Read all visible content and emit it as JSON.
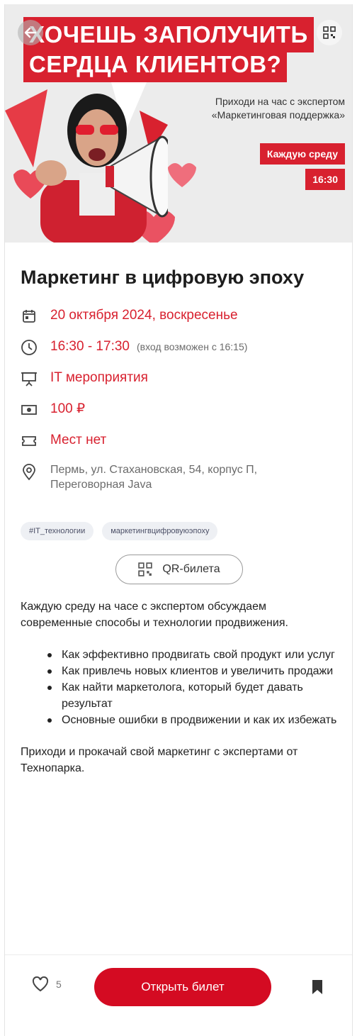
{
  "banner": {
    "headline_line1": "ХОЧЕШЬ ЗАПОЛУЧИТЬ",
    "headline_line2": "СЕРДЦА КЛИЕНТОВ?",
    "promo_line1": "Приходи на час с экспертом",
    "promo_line2": "«Маркетинговая поддержка»",
    "badge_day": "Каждую среду",
    "badge_time": "16:30"
  },
  "event": {
    "title": "Маркетинг в цифровую эпоху",
    "date": "20 октября 2024, воскресенье",
    "time": "16:30 - 17:30",
    "entry_note": "(вход возможен с 16:15)",
    "category": "IT мероприятия",
    "price": "100 ₽",
    "seats": "Мест нет",
    "address_line1": "Пермь, ул. Стахановская, 54, корпус П,",
    "address_line2": "Переговорная Java"
  },
  "tags": [
    "#IT_технологии",
    "маркетингвцифровуюэпоху"
  ],
  "qr_ticket_label": "QR-билета",
  "description": {
    "intro": "Каждую среду на часе с экспертом обсуждаем современные способы и технологии продвижения.",
    "bullets": [
      "Как эффективно продвигать свой продукт или услуг",
      "Как привлечь новых клиентов и увеличить продажи",
      "Как найти маркетолога, который будет давать результат",
      "Основные ошибки в продвижении и как их избежать"
    ],
    "outro": "Приходи и прокачай свой маркетинг с экспертами от Технопарка."
  },
  "bottom_bar": {
    "like_count": "5",
    "open_ticket_label": "Открыть билет"
  },
  "colors": {
    "accent": "#d8212f",
    "button": "#d40b22"
  }
}
